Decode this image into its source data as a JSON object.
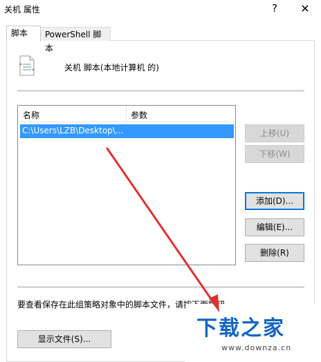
{
  "window": {
    "title": "关机 属性",
    "help_glyph": "?",
    "close_glyph": "✕"
  },
  "tabs": [
    {
      "label": "脚本",
      "active": true
    },
    {
      "label": "PowerShell 脚本",
      "active": false
    }
  ],
  "header": {
    "label": "关机 脚本(本地计算机 的)"
  },
  "script_list": {
    "columns": [
      "名称",
      "参数"
    ],
    "rows": [
      {
        "name": "C:\\Users\\LZB\\Desktop\\...",
        "params": "",
        "selected": true
      }
    ]
  },
  "buttons": {
    "move_up": "上移(U)",
    "move_down": "下移(W)",
    "add": "添加(D)...",
    "edit": "编辑(E)...",
    "remove": "删除(R)",
    "show_files": "显示文件(S)..."
  },
  "footer_text": "要查看保存在此组策略对象中的脚本文件，请按下面按钮",
  "watermark": {
    "main": "下载之家",
    "url": "www.downza.cn"
  },
  "colors": {
    "selection": "#3399ff",
    "accent": "#0078d7",
    "annotation_arrow": "#e03030",
    "watermark_blue": "#1565c0"
  }
}
